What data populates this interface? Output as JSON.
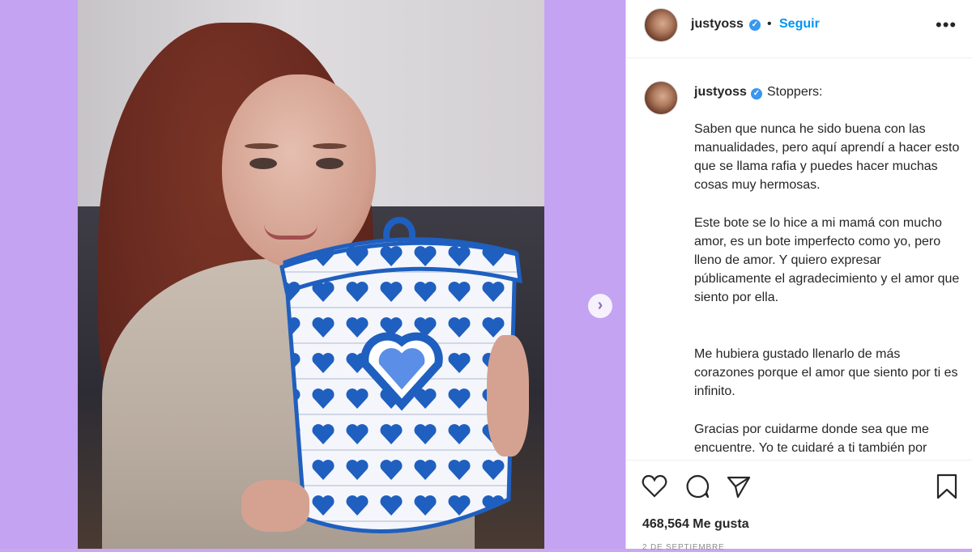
{
  "post": {
    "username": "justyoss",
    "follow_label": "Seguir",
    "more_label": "•••",
    "caption_title": "Stoppers:",
    "caption_paragraphs": [
      "Saben que nunca he sido buena con las manualidades, pero aquí aprendí a hacer esto que se llama rafia y puedes hacer muchas cosas muy hermosas.",
      "Este bote se lo hice a mi mamá con mucho amor, es un bote imperfecto como yo, pero lleno de amor. Y quiero expresar públicamente el agradecimiento y el amor que siento por ella.",
      "Me hubiera gustado llenarlo de más corazones porque el amor que siento por ti es infinito.",
      "Gracias por cuidarme donde sea que me encuentre. Yo te cuidaré a ti también por"
    ],
    "likes_text": "468,564 Me gusta",
    "date_text": "2 DE SEPTIEMBRE"
  },
  "ui": {
    "next_label": "›",
    "verified_mark": "✓",
    "separator": "•"
  },
  "icons": {
    "like": "heart-icon",
    "comment": "comment-icon",
    "share": "share-icon",
    "save": "bookmark-icon",
    "next": "chevron-right-icon"
  },
  "colors": {
    "background": "#c4a3f2",
    "accent": "#0095f6",
    "verified": "#3897f0",
    "basket_blue": "#1f5fbf"
  }
}
